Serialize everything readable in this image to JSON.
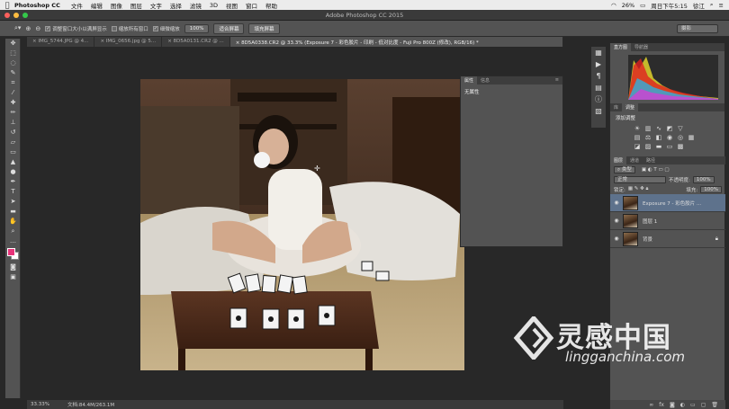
{
  "menubar": {
    "app": "Photoshop CC",
    "items": [
      "文件",
      "编辑",
      "图像",
      "图层",
      "文字",
      "选择",
      "滤镜",
      "3D",
      "视图",
      "窗口",
      "帮助"
    ],
    "battery": "26%",
    "clock": "周日下午5:15",
    "user": "徐江"
  },
  "window": {
    "title": "Adobe Photoshop CC 2015"
  },
  "options": {
    "zoom_label": "Q",
    "chk1": "调整窗口大小以满屏显示",
    "chk2": "缩放所有窗口",
    "chk3": "细微缩放",
    "btn_100": "100%",
    "btn_fit": "适合屏幕",
    "btn_fill": "填充屏幕",
    "workspace": "摄影"
  },
  "tabs": [
    "IMG_5744.JPG @ 4...",
    "IMG_0656.jpg @ 5...",
    "8D5A0131.CR2 @ ...",
    "8D5A0338.CR2 @ 33.3% (Exposure 7 - 彩色胶片 - 印刷 - 低对比度 - Fuji Pro 800Z  (修改), RGB/16) *"
  ],
  "props_panel": {
    "tab1": "属性",
    "tab2": "信息",
    "content": "无属性"
  },
  "status": {
    "zoom": "33.33%",
    "doc": "文档:84.4M/263.1M"
  },
  "right": {
    "histo_tab1": "直方图",
    "histo_tab2": "导航器",
    "adj_tab1": "库",
    "adj_tab2": "调整",
    "adj_add": "添加调整",
    "layers_tab1": "图层",
    "layers_tab2": "通道",
    "layers_tab3": "路径",
    "kind": "类型",
    "blend": "正常",
    "opacity_label": "不透明度:",
    "opacity": "100%",
    "lock_label": "锁定:",
    "fill_label": "填充:",
    "fill": "100%",
    "layers": [
      {
        "name": "Exposure 7 - 彩色胶片 ...",
        "selected": true
      },
      {
        "name": "图层 1",
        "selected": false
      },
      {
        "name": "背景",
        "selected": false
      }
    ]
  },
  "watermark": {
    "cn": "灵感中国",
    "en": "lingganchina.com"
  },
  "colors": {
    "panel": "#535353",
    "dark": "#282828",
    "selected": "#5e728c",
    "foreground": "#e8347a",
    "background": "#ffffff"
  },
  "icons": [
    "apple-icon",
    "zoom-icon",
    "eye-icon",
    "lock-icon",
    "trash-icon",
    "new-layer-icon",
    "folder-icon",
    "fx-icon",
    "mask-icon",
    "adjustment-icon",
    "link-icon"
  ]
}
